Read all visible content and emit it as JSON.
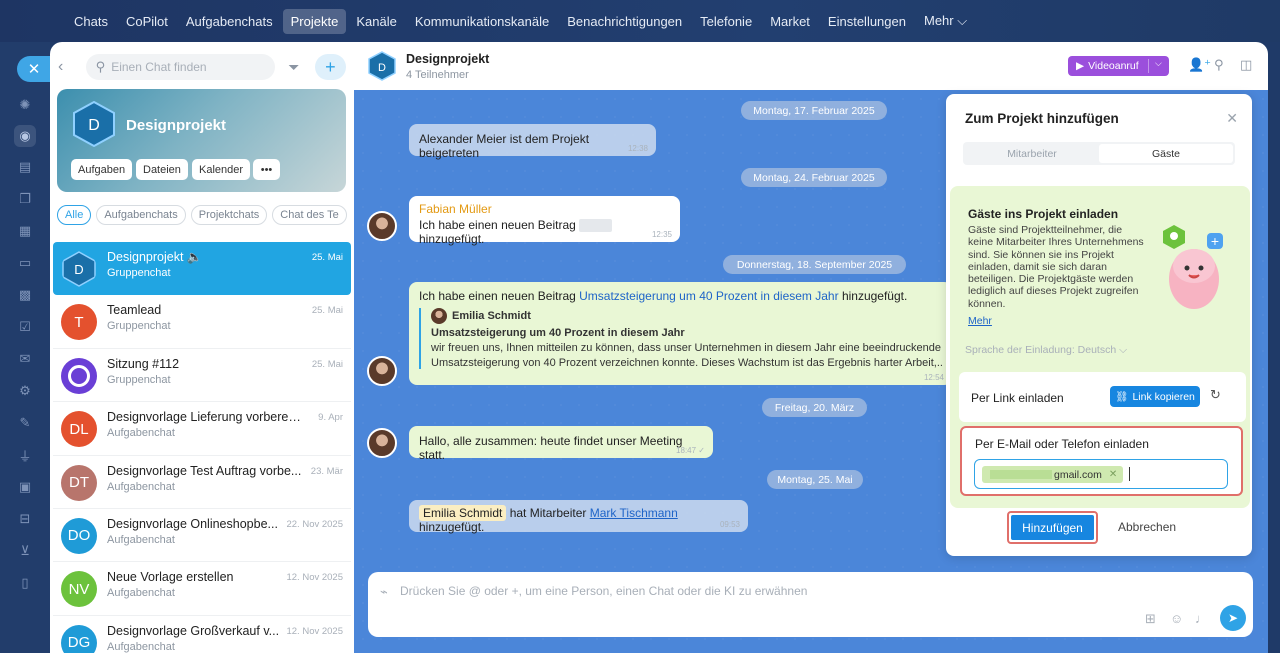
{
  "topnav": {
    "items": [
      "Chats",
      "CoPilot",
      "Aufgabenchats",
      "Projekte",
      "Kanäle",
      "Kommunikationskanäle",
      "Benachrichtigungen",
      "Telefonie",
      "Market",
      "Einstellungen",
      "Mehr ⌵"
    ],
    "active": "Projekte"
  },
  "rail": {
    "close": "✕"
  },
  "sidebar": {
    "search_placeholder": "Einen Chat finden",
    "project": {
      "initial": "D",
      "name": "Designprojekt",
      "chips": [
        "Aufgaben",
        "Dateien",
        "Kalender",
        "•••"
      ]
    },
    "filters": [
      "Alle",
      "Aufgabenchats",
      "Projektchats",
      "Chat des Te"
    ],
    "chats": [
      {
        "initial": "D",
        "title": "Designprojekt 🔈",
        "sub": "Gruppenchat",
        "date": "25. Mai",
        "color": "#3fa6e6"
      },
      {
        "initial": "T",
        "title": "Teamlead",
        "sub": "Gruppenchat",
        "date": "25. Mai",
        "color": "#e4512e"
      },
      {
        "initial": "",
        "title": "Sitzung #112",
        "sub": "Gruppenchat",
        "date": "25. Mai",
        "color": "#6a3fd6"
      },
      {
        "initial": "DL",
        "title": "Designvorlage Lieferung vorbereiten",
        "sub": "Aufgabenchat",
        "date": "9. Apr",
        "color": "#e4512e"
      },
      {
        "initial": "DT",
        "title": "Designvorlage Test Auftrag vorbe...",
        "sub": "Aufgabenchat",
        "date": "23. Mär",
        "color": "#b8756c"
      },
      {
        "initial": "DO",
        "title": "Designvorlage Onlineshopbe...",
        "sub": "Aufgabenchat",
        "date": "22. Nov 2025",
        "color": "#1f9bd7"
      },
      {
        "initial": "NV",
        "title": "Neue Vorlage erstellen",
        "sub": "Aufgabenchat",
        "date": "12. Nov 2025",
        "color": "#6cc23c"
      },
      {
        "initial": "DG",
        "title": "Designvorlage Großverkauf v...",
        "sub": "Aufgabenchat",
        "date": "12. Nov 2025",
        "color": "#1f9bd7"
      }
    ]
  },
  "header": {
    "initial": "D",
    "title": "Designprojekt",
    "sub": "4 Teilnehmer",
    "video": "Videoanruf"
  },
  "chat": {
    "dates": [
      "Montag, 17. Februar 2025",
      "Montag, 24. Februar 2025",
      "Donnerstag, 18. September 2025",
      "Freitag, 20. März",
      "Montag, 25. Mai"
    ],
    "m1": {
      "text": "Alexander Meier ist dem Projekt beigetreten",
      "time": "12:38"
    },
    "m2": {
      "author": "Fabian Müller",
      "text_a": "Ich habe einen neuen Beitrag",
      "text_b": "hinzugefügt.",
      "time": "12:35"
    },
    "m3": {
      "text_a": "Ich habe einen neuen Beitrag",
      "link": "Umsatzsteigerung um 40 Prozent in diesem Jahr",
      "text_b": "hinzugefügt.",
      "q_author": "Emilia Schmidt",
      "q_title": "Umsatzsteigerung um 40 Prozent in diesem Jahr",
      "q_line1": "wir freuen uns, Ihnen mitteilen zu können, dass unser Unternehmen in diesem Jahr eine beeindruckende",
      "q_line2": "Umsatzsteigerung von 40 Prozent verzeichnen konnte. Dieses Wachstum ist das Ergebnis harter Arbeit,...",
      "time": "12:54"
    },
    "m4": {
      "text": "Hallo, alle zusammen: heute findet unser Meeting statt.",
      "time": "18:47 ✓"
    },
    "m5": {
      "mention": "Emilia Schmidt",
      "text_a": "hat Mitarbeiter",
      "link": "Mark Tischmann",
      "text_b": "hinzugefügt.",
      "time": "09:53"
    }
  },
  "composer": {
    "placeholder": "Drücken Sie @ oder +, um eine Person, einen Chat oder die KI zu erwähnen"
  },
  "panel": {
    "title": "Zum Projekt hinzufügen",
    "tabs": [
      "Mitarbeiter",
      "Gäste"
    ],
    "invite_title": "Gäste ins Projekt einladen",
    "invite_text": "Gäste sind Projektteilnehmer, die keine Mitarbeiter Ihres Unternehmens sind. Sie können sie ins Projekt einladen, damit sie sich daran beteiligen. Die Projektgäste werden lediglich auf dieses Projekt zugreifen können.",
    "more": "Mehr",
    "lang_label": "Sprache der Einladung:",
    "lang_value": "Deutsch ⌵",
    "link_label": "Per Link einladen",
    "copy_label": "Link kopieren",
    "email_label": "Per E-Mail oder Telefon einladen",
    "email_chip": "gmail.com",
    "add": "Hinzufügen",
    "cancel": "Abbrechen"
  }
}
